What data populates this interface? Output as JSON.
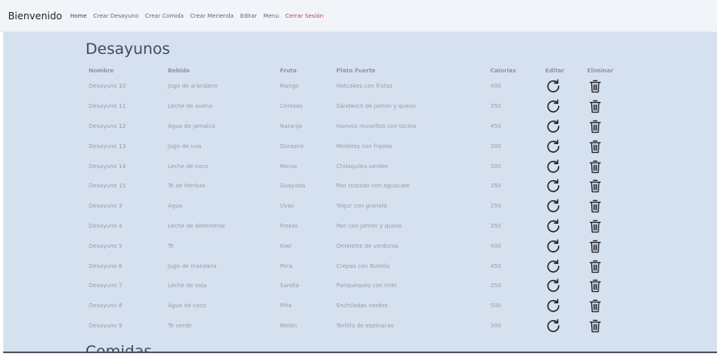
{
  "navbar": {
    "brand": "Bienvenido",
    "links": [
      "Home",
      "Crear Desayuno",
      "Crear Comida",
      "Crear Merienda",
      "Editar",
      "Menu"
    ],
    "logout": "Cerrar Sesión"
  },
  "sections": {
    "desayunos_title": "Desayunos",
    "comidas_title": "Comidas"
  },
  "table": {
    "columns": [
      "Nombre",
      "Bebida",
      "Fruta",
      "Plato Fuerte",
      "Calorias",
      "Editar",
      "Eliminar"
    ],
    "rows": [
      [
        "Desayuno 10",
        "Jugo de arándano",
        "Mango",
        "Hotcakes con frutas",
        "400"
      ],
      [
        "Desayuno 11",
        "Leche de avena",
        "Cerezas",
        "Sándwich de jamón y queso",
        "350"
      ],
      [
        "Desayuno 12",
        "Agua de jamaica",
        "Naranja",
        "Huevos revueltos con tocino",
        "450"
      ],
      [
        "Desayuno 13",
        "Jugo de uva",
        "Durazno",
        "Molletes con frijoles",
        "300"
      ],
      [
        "Desayuno 14",
        "Leche de coco",
        "Moras",
        "Chilaquiles verdes",
        "500"
      ],
      [
        "Desayuno 15",
        "Té de hierbas",
        "Guayaba",
        "Pan tostado con aguacate",
        "350"
      ],
      [
        "Desayuno 3",
        "Agua",
        "Uvas",
        "Yogur con granola",
        "250"
      ],
      [
        "Desayuno 4",
        "Leche de almendras",
        "Fresas",
        "Pan con jamón y queso",
        "350"
      ],
      [
        "Desayuno 5",
        "Té",
        "Kiwi",
        "Omelette de verduras",
        "400"
      ],
      [
        "Desayuno 6",
        "Jugo de manzana",
        "Pera",
        "Crepas con Nutella",
        "450"
      ],
      [
        "Desayuno 7",
        "Leche de soja",
        "Sandía",
        "Panqueques con miel",
        "350"
      ],
      [
        "Desayuno 8",
        "Agua de coco",
        "Piña",
        "Enchiladas verdes",
        "500"
      ],
      [
        "Desayuno 9",
        "Té verde",
        "Melón",
        "Tortilla de espinacas",
        "300"
      ]
    ],
    "edit_icon": "refresh-icon",
    "delete_icon": "trash-icon"
  },
  "colors": {
    "navbar_bg": "#f1f5fa",
    "content_bg": "#d6e1f0",
    "logout": "#d9364a",
    "title": "#3f4a5c"
  }
}
